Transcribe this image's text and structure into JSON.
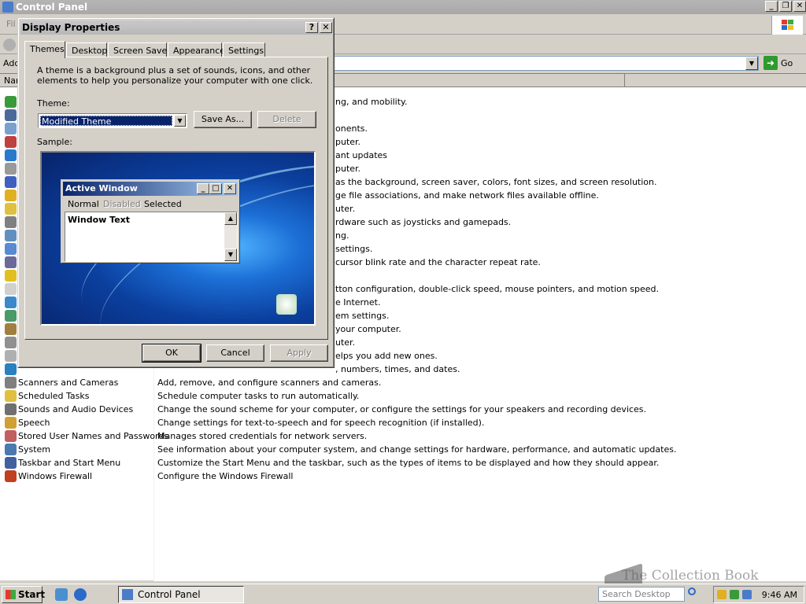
{
  "main_window": {
    "title": "Control Panel",
    "menu_partial": "Fil",
    "address_label": "Add",
    "go_label": "Go",
    "header_col1": "Nan",
    "colors": {
      "title_bg": "#a8a8a8",
      "content_bg": "#ffffff"
    }
  },
  "items": [
    {
      "name": "",
      "desc_right": "ng, and mobility.",
      "icon_color": "#3a9a3a"
    },
    {
      "name": "",
      "desc_right": "",
      "icon_color": "#4a6a9a"
    },
    {
      "name": "",
      "desc_right": "onents.",
      "icon_color": "#7aa0d0"
    },
    {
      "name": "",
      "desc_right": "puter.",
      "icon_color": "#c04040"
    },
    {
      "name": "",
      "desc_right": "ant updates",
      "icon_color": "#2a7acb"
    },
    {
      "name": "",
      "desc_right": "puter.",
      "icon_color": "#9a9a9a"
    },
    {
      "name": "",
      "desc_right": "as the background, screen saver, colors, font sizes, and screen resolution.",
      "icon_color": "#4060c0"
    },
    {
      "name": "",
      "desc_right": "ge file associations, and make network files available offline.",
      "icon_color": "#e0b020"
    },
    {
      "name": "",
      "desc_right": "uter.",
      "icon_color": "#e0c040"
    },
    {
      "name": "",
      "desc_right": "rdware such as joysticks and gamepads.",
      "icon_color": "#808080"
    },
    {
      "name": "",
      "desc_right": "ng.",
      "icon_color": "#6090c0"
    },
    {
      "name": "",
      "desc_right": "settings.",
      "icon_color": "#5a8ad0"
    },
    {
      "name": "",
      "desc_right": "cursor blink rate and the character repeat rate.",
      "icon_color": "#6a6a9a"
    },
    {
      "name": "",
      "desc_right": "",
      "icon_color": "#e0c020"
    },
    {
      "name": "",
      "desc_right": "tton configuration, double-click speed, mouse pointers, and motion speed.",
      "icon_color": "#d0d0d0"
    },
    {
      "name": "",
      "desc_right": "e Internet.",
      "icon_color": "#3a8acb"
    },
    {
      "name": "",
      "desc_right": "em settings.",
      "icon_color": "#4a9a6a"
    },
    {
      "name": "",
      "desc_right": "your computer.",
      "icon_color": "#a08040"
    },
    {
      "name": "",
      "desc_right": "uter.",
      "icon_color": "#909090"
    },
    {
      "name": "",
      "desc_right": "elps you add new ones.",
      "icon_color": "#b0b0b0"
    },
    {
      "name": "",
      "desc_right": ", numbers, times, and dates.",
      "icon_color": "#2a80c0"
    },
    {
      "name": "Scanners and Cameras",
      "desc": "Add, remove, and configure scanners and cameras.",
      "icon_color": "#808080"
    },
    {
      "name": "Scheduled Tasks",
      "desc": "Schedule computer tasks to run automatically.",
      "icon_color": "#e0c040"
    },
    {
      "name": "Sounds and Audio Devices",
      "desc": "Change the sound scheme for your computer, or configure the settings for your speakers and recording devices.",
      "icon_color": "#707070"
    },
    {
      "name": "Speech",
      "desc": "Change settings for text-to-speech and for speech recognition (if installed).",
      "icon_color": "#d0a030"
    },
    {
      "name": "Stored User Names and Passwords",
      "desc": "Manages stored credentials for network servers.",
      "icon_color": "#c06060"
    },
    {
      "name": "System",
      "desc": "See information about your computer system, and change settings for hardware, performance, and automatic updates.",
      "icon_color": "#4a7ab0"
    },
    {
      "name": "Taskbar and Start Menu",
      "desc": "Customize the Start Menu and the taskbar, such as the types of items to be displayed and how they should appear.",
      "icon_color": "#4060a0"
    },
    {
      "name": "Windows Firewall",
      "desc": "Configure the Windows Firewall",
      "icon_color": "#c04020"
    }
  ],
  "dialog": {
    "title": "Display Properties",
    "help_btn": "?",
    "close_btn": "✕",
    "tabs": [
      "Themes",
      "Desktop",
      "Screen Saver",
      "Appearance",
      "Settings"
    ],
    "description": "A theme is a background plus a set of sounds, icons, and other elements to help you personalize your computer with one click.",
    "theme_label": "Theme:",
    "theme_value": "Modified Theme",
    "save_as": "Save As...",
    "delete": "Delete",
    "sample_label": "Sample:",
    "ok": "OK",
    "cancel": "Cancel",
    "apply": "Apply",
    "preview": {
      "title": "Active Window",
      "menu_normal": "Normal",
      "menu_disabled": "Disabled",
      "menu_selected": "Selected",
      "window_text": "Window Text"
    }
  },
  "taskbar": {
    "start": "Start",
    "task_label": "Control Panel",
    "search_placeholder": "Search Desktop",
    "clock": "9:46 AM"
  },
  "watermark": "The Collection Book"
}
